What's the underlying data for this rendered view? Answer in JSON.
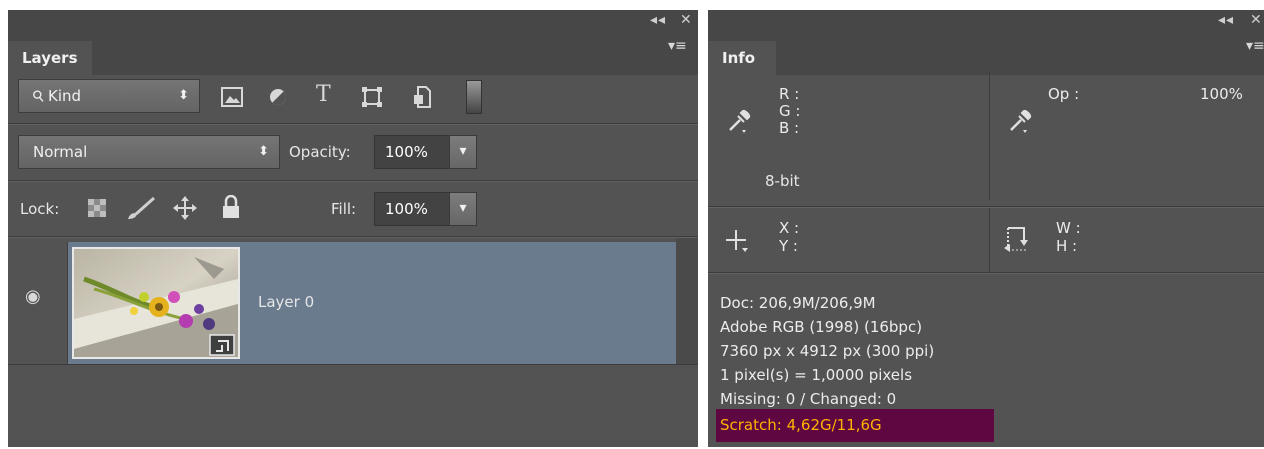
{
  "layers_panel": {
    "collapse_glyph": "◂◂",
    "close_glyph": "✕",
    "tab_label": "Layers",
    "menu_glyph": "▾≡",
    "filter": {
      "search_glyph": "⚲",
      "value": "Kind",
      "arrows": "⬍"
    },
    "filter_icons": [
      "image-filter-icon",
      "adjustment-filter-icon",
      "type-filter-icon",
      "shape-filter-icon",
      "smart-object-filter-icon",
      "filter-toggle-icon"
    ],
    "type_glyph": "T",
    "blend_mode": {
      "value": "Normal",
      "arrows": "⬍"
    },
    "opacity": {
      "label": "Opacity:",
      "value": "100%",
      "step_glyph": "▾"
    },
    "lock": {
      "label": "Lock:"
    },
    "fill": {
      "label": "Fill:",
      "value": "100%",
      "step_glyph": "▾"
    },
    "eye_glyph": "◉",
    "layer": {
      "name": "Layer 0",
      "selected": true
    }
  },
  "info_panel": {
    "collapse_glyph": "◂◂",
    "close_glyph": "✕",
    "tab_label": "Info",
    "menu_glyph": "▾≡",
    "color_readout": {
      "r_label": "R :",
      "g_label": "G :",
      "b_label": "B :",
      "bit_depth": "8-bit"
    },
    "op_readout": {
      "label": "Op :",
      "value": "100%"
    },
    "xy_readout": {
      "x_label": "X :",
      "y_label": "Y :"
    },
    "wh_readout": {
      "w_label": "W :",
      "h_label": "H :"
    },
    "status": [
      "Doc: 206,9M/206,9M",
      "Adobe RGB (1998) (16bpc)",
      "7360 px x 4912 px (300 ppi)",
      "1 pixel(s) = 1,0000 pixels",
      "Missing: 0 / Changed: 0"
    ],
    "scratch": "Scratch: 4,62G/11,6G"
  },
  "colors": {
    "panel_bg": "#535353",
    "header_bg": "#474747",
    "selected_layer_bg": "#6a7b8e",
    "scratch_bg": "#5f0741",
    "scratch_text": "#ffb200"
  }
}
